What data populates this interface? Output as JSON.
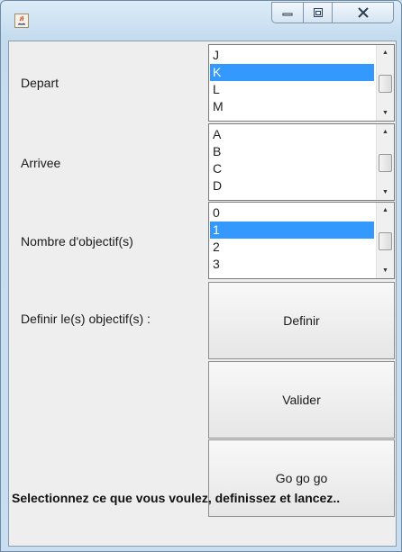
{
  "window": {
    "controls": [
      "minimize",
      "maximize",
      "close"
    ]
  },
  "form": {
    "depart_label": "Depart",
    "arrivee_label": "Arrivee",
    "nombre_label": "Nombre d'objectif(s)",
    "definir_label": "Definir le(s) objectif(s) :"
  },
  "lists": {
    "depart": {
      "items": [
        "J",
        "K",
        "L",
        "M"
      ],
      "selected": "K"
    },
    "arrivee": {
      "items": [
        "A",
        "B",
        "C",
        "D"
      ],
      "selected": ""
    },
    "nombre": {
      "items": [
        "0",
        "1",
        "2",
        "3"
      ],
      "selected": "1"
    }
  },
  "buttons": {
    "definir": "Definir",
    "valider": "Valider",
    "go": "Go go go"
  },
  "status": "Selectionnez ce que vous voulez, definissez et lancez.."
}
